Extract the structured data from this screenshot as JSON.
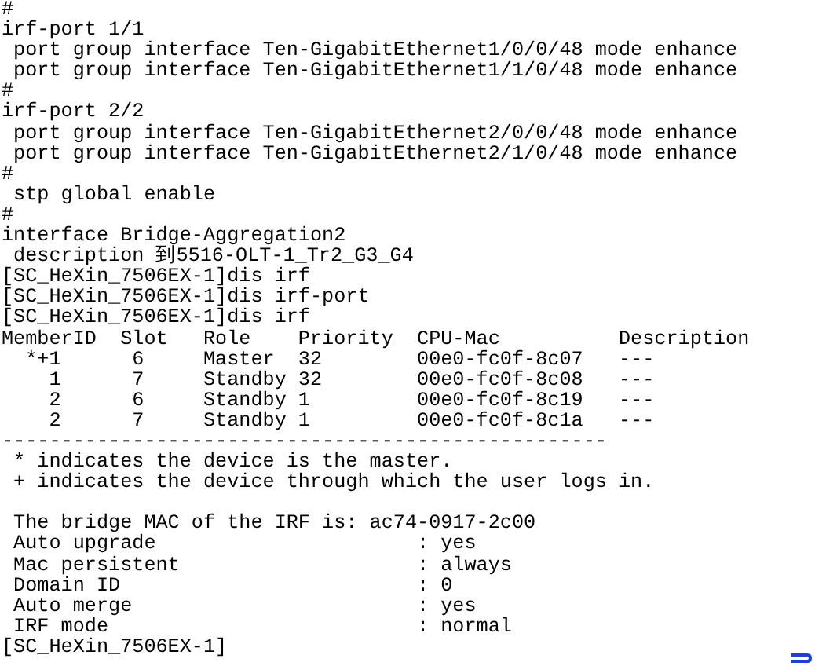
{
  "terminal": {
    "blocks": [
      {
        "lines": [
          "#",
          "irf-port 1/1",
          " port group interface Ten-GigabitEthernet1/0/0/48 mode enhance",
          " port group interface Ten-GigabitEthernet1/1/0/48 mode enhance",
          "#",
          "irf-port 2/2",
          " port group interface Ten-GigabitEthernet2/0/0/48 mode enhance",
          " port group interface Ten-GigabitEthernet2/1/0/48 mode enhance",
          "#",
          " stp global enable",
          "#",
          "interface Bridge-Aggregation2",
          " description 到5516-OLT-1_Tr2_G3_G4",
          "[SC_HeXin_7506EX-1]dis irf",
          "[SC_HeXin_7506EX-1]dis irf-port",
          "[SC_HeXin_7506EX-1]dis irf",
          "MemberID  Slot   Role    Priority  CPU-Mac          Description",
          "  *+1      6     Master  32        00e0-fc0f-8c07   ---",
          "    1      7     Standby 32        00e0-fc0f-8c08   ---",
          "    2      6     Standby 1         00e0-fc0f-8c19   ---",
          "    2      7     Standby 1         00e0-fc0f-8c1a   ---",
          "---------------------------------------------------",
          " * indicates the device is the master.",
          " + indicates the device through which the user logs in."
        ]
      },
      {
        "lines": [
          " The bridge MAC of the IRF is: ac74-0917-2c00",
          " Auto upgrade                      : yes",
          " Mac persistent                    : always",
          " Domain ID                         : 0",
          " Auto merge                        : yes",
          " IRF mode                          : normal",
          "[SC_HeXin_7506EX-1]"
        ]
      }
    ]
  }
}
